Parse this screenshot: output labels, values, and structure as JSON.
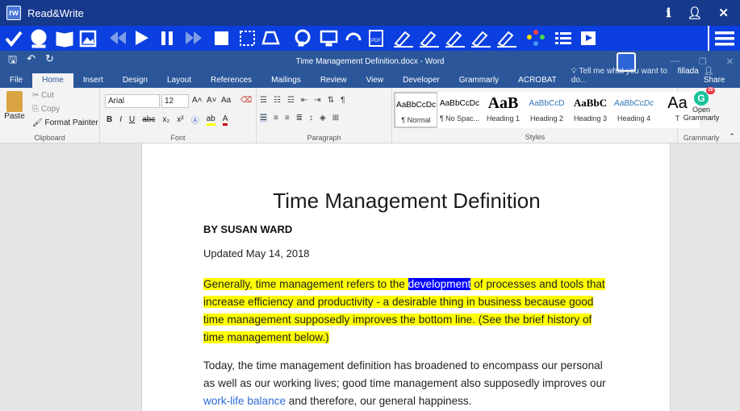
{
  "rw": {
    "title": "Read&Write",
    "badge": "rw",
    "tools": [
      "check-icon",
      "speech-icon",
      "dictionary-icon",
      "picture-dictionary-icon",
      "rewind-icon",
      "play-icon",
      "pause-icon",
      "forward-icon",
      "stop-icon",
      "screenshot-reader-icon",
      "audio-maker-icon",
      "listen-icon",
      "screen-masking-icon",
      "verb-checker-icon",
      "pdf-reader-icon",
      "highlight-cyan-icon",
      "highlight-yellow-icon",
      "highlight-green-icon",
      "highlight-pink-icon",
      "highlight-clear-icon",
      "collect-highlights-icon",
      "vocabulary-list-icon",
      "voice-notes-icon",
      "menu-icon"
    ]
  },
  "word": {
    "doc_title": "Time Management Definition.docx - Word",
    "tabs": [
      "File",
      "Home",
      "Insert",
      "Design",
      "Layout",
      "References",
      "Mailings",
      "Review",
      "View",
      "Developer",
      "Grammarly",
      "ACROBAT"
    ],
    "active_tab": "Home",
    "tell_me": "Tell me what you want to do...",
    "user": "fillada",
    "share": "Share"
  },
  "ribbon": {
    "clipboard": {
      "paste": "Paste",
      "cut": "Cut",
      "copy": "Copy",
      "format_painter": "Format Painter",
      "label": "Clipboard"
    },
    "font": {
      "name": "Arial",
      "size": "12",
      "label": "Font",
      "aa": "Aa",
      "bold": "B",
      "italic": "I",
      "underline": "U",
      "strike": "abc",
      "sub": "x₂",
      "sup": "x²"
    },
    "paragraph": {
      "label": "Paragraph",
      "pilcrow": "¶"
    },
    "styles": {
      "label": "Styles",
      "items": [
        {
          "preview": "AaBbCcDc",
          "name": "¶ Normal"
        },
        {
          "preview": "AaBbCcDc",
          "name": "¶ No Spac..."
        },
        {
          "preview": "AaB",
          "name": "Heading 1"
        },
        {
          "preview": "AaBbCcD",
          "name": "Heading 2"
        },
        {
          "preview": "AaBbC",
          "name": "Heading 3"
        },
        {
          "preview": "AaBbCcDc",
          "name": "Heading 4"
        },
        {
          "preview": "Aa",
          "name": "T"
        }
      ]
    },
    "grammarly": {
      "button": "Open Grammarly",
      "label": "Grammarly",
      "count": "20"
    }
  },
  "document": {
    "title": "Time Management Definition",
    "author": "BY SUSAN WARD",
    "updated": "Updated May 14, 2018",
    "p1_before": "Generally, time management refers to the ",
    "p1_selected": "development",
    "p1_after": " of processes and tools that increase efficiency and productivity - a desirable thing in business because good time management supposedly improves the bottom line. (See the brief history of time management below.)",
    "p2_before": "Today, the time management definition has broadened to encompass our personal as well as our working lives; good time management also supposedly improves our ",
    "p2_link": "work-life balance",
    "p2_after": " and therefore, our general happiness."
  },
  "colors": {
    "rw_title": "#16398c",
    "rw_bar": "#0b3fe0",
    "word_blue": "#2b579a",
    "highlight": "#ffff00",
    "selection": "#0000ff"
  }
}
